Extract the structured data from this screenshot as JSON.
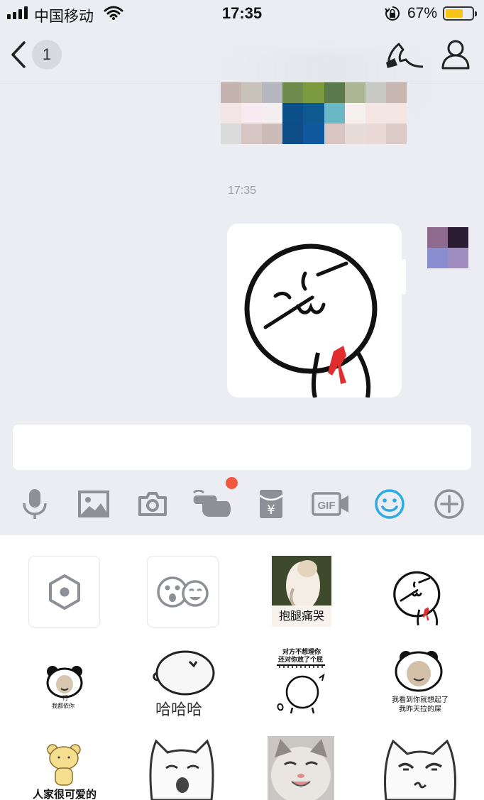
{
  "status_bar": {
    "carrier": "中国移动",
    "time": "17:35",
    "battery_percent": "67%",
    "battery_level": 0.67,
    "icons": [
      "signal-icon",
      "wifi-icon",
      "rotation-lock-icon",
      "battery-icon"
    ]
  },
  "nav": {
    "unread_count": "1",
    "icons": [
      "back-icon",
      "phone-icon",
      "profile-icon"
    ]
  },
  "chat": {
    "timestamp": "17:35"
  },
  "input": {
    "value": ""
  },
  "toolbar": {
    "items": [
      "microphone-icon",
      "image-icon",
      "camera-icon",
      "poke-icon",
      "red-packet-icon",
      "gif-icon",
      "emoji-icon",
      "plus-icon"
    ],
    "gif_label": "GIF",
    "accent_color": "#2aabe6",
    "icon_color": "#8e9097",
    "badge_color": "#f1573f"
  },
  "sticker_panel": {
    "captions": {
      "hug_leg_cry": "抱腿痛哭",
      "panda_small_top": "行",
      "panda_small_bottom": "我都依你",
      "hahaha": "哈哈哈",
      "ignore_top": "对方不想理你",
      "ignore_bottom": "还对你放了个屁",
      "panda_right_top": "我看到你就想起了",
      "panda_right_bottom": "我昨天拉的屎",
      "cute": "人家很可爱的"
    }
  }
}
